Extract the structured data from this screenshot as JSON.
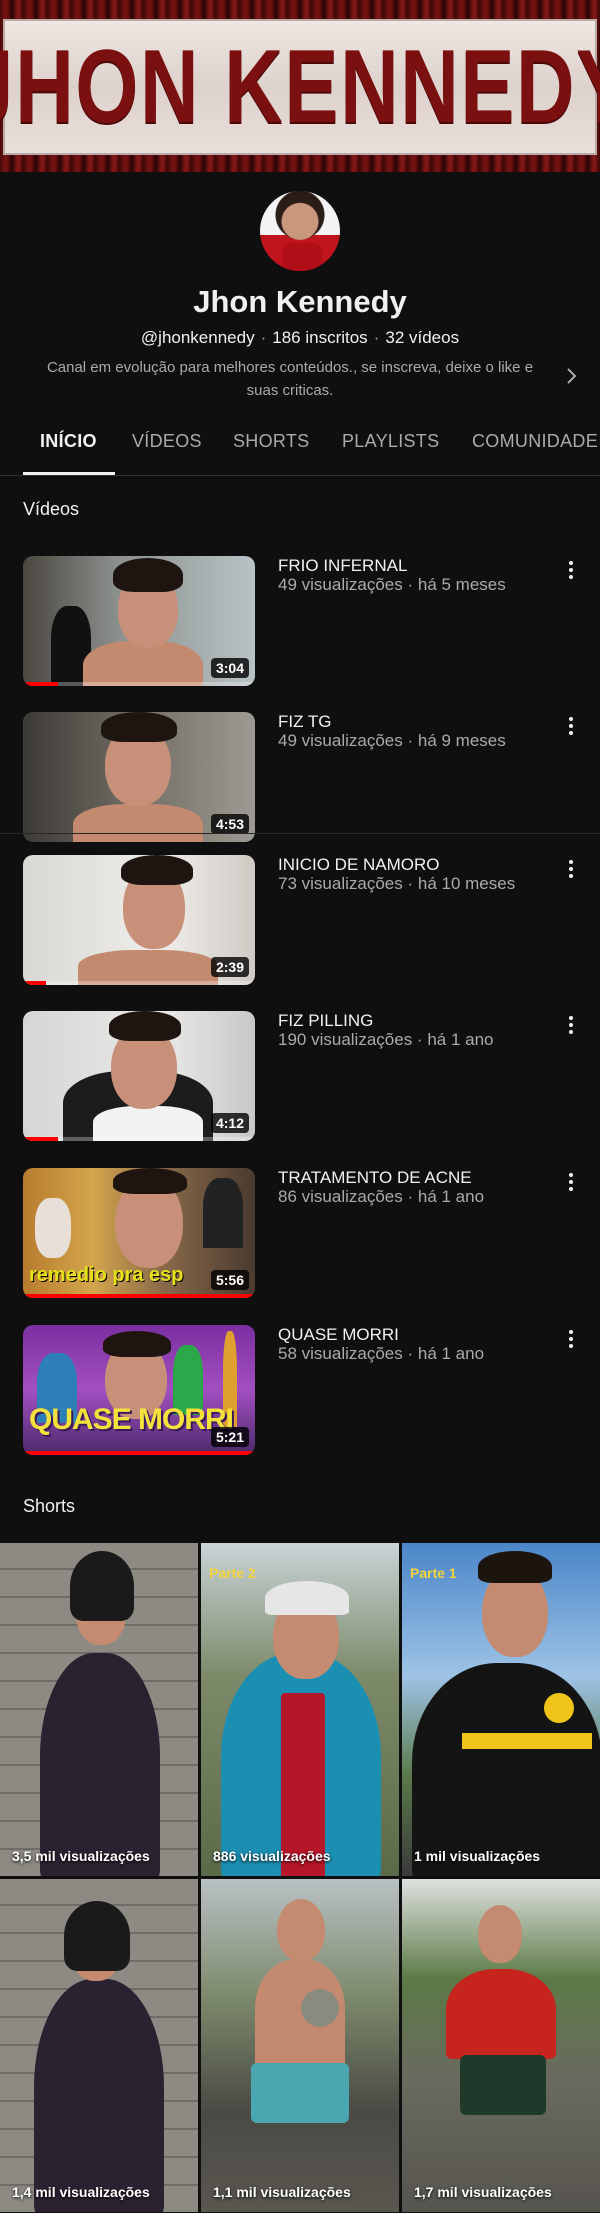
{
  "banner": {
    "text": "JHON KENNEDY"
  },
  "channel": {
    "name": "Jhon Kennedy",
    "handle": "@jhonkennedy",
    "subscribers": "186 inscritos",
    "video_count": "32 vídeos",
    "description": "Canal em evolução para melhores conteúdos., se inscreva, deixe o like e suas criticas."
  },
  "tabs": [
    {
      "label": "INÍCIO",
      "active": true
    },
    {
      "label": "VÍDEOS"
    },
    {
      "label": "SHORTS"
    },
    {
      "label": "PLAYLISTS"
    },
    {
      "label": "COMUNIDADE"
    }
  ],
  "sections": {
    "videos_title": "Vídeos",
    "shorts_title": "Shorts"
  },
  "videos": [
    {
      "title": "FRIO INFERNAL",
      "views": "49 visualizações",
      "age": "há 5 meses",
      "duration": "3:04",
      "watched_fraction": 0.15
    },
    {
      "title": "FIZ TG",
      "views": "49 visualizações",
      "age": "há 9 meses",
      "duration": "4:53",
      "watched_fraction": 0.0
    },
    {
      "title": "INICIO DE NAMORO",
      "views": "73 visualizações",
      "age": "há 10 meses",
      "duration": "2:39",
      "watched_fraction": 0.1
    },
    {
      "title": "FIZ PILLING",
      "views": "190 visualizações",
      "age": "há 1 ano",
      "duration": "4:12",
      "watched_fraction": 0.15
    },
    {
      "title": "TRATAMENTO DE ACNE",
      "views": "86 visualizações",
      "age": "há 1 ano",
      "duration": "5:56",
      "watched_fraction": 1.0,
      "overlay_text": "remedio pra esp"
    },
    {
      "title": "QUASE MORRI",
      "views": "58 visualizações",
      "age": "há 1 ano",
      "duration": "5:21",
      "watched_fraction": 1.0,
      "overlay_text": "QUASE MORRI"
    }
  ],
  "shorts": [
    {
      "views": "3,5 mil visualizações"
    },
    {
      "views": "886 visualizações",
      "tag": "Parte 2"
    },
    {
      "views": "1 mil visualizações",
      "tag": "Parte 1"
    },
    {
      "views": "1,4 mil visualizações"
    },
    {
      "views": "1,1 mil visualizações"
    },
    {
      "views": "1,7 mil visualizações"
    }
  ],
  "colors": {
    "background": "#0f0f0f",
    "text_primary": "#f1f1f1",
    "text_secondary": "#aaaaaa",
    "progress": "#ff0000",
    "banner_red": "#7a1010"
  },
  "icons": {
    "menu": "more-vert-icon",
    "expand": "chevron-right-icon"
  }
}
